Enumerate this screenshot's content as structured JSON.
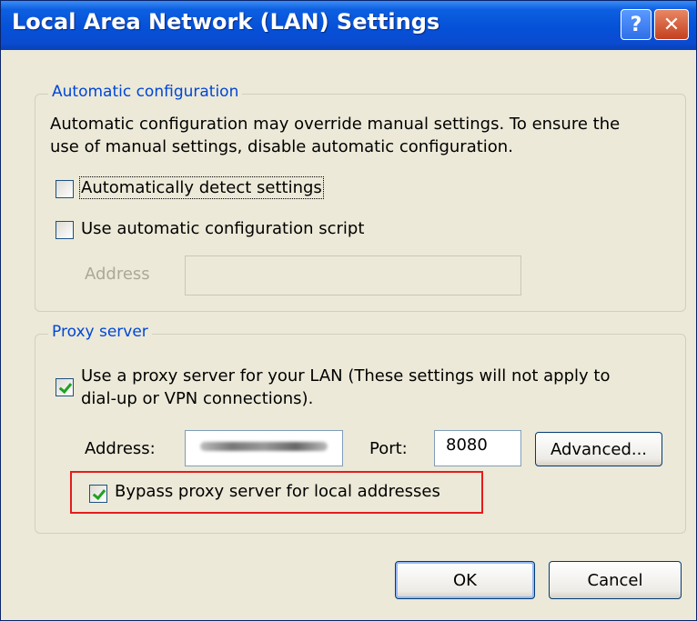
{
  "window": {
    "title": "Local Area Network (LAN) Settings",
    "help_icon": "?",
    "close_icon": "✕"
  },
  "auto_config": {
    "legend": "Automatic configuration",
    "description_line1": "Automatic configuration may override manual settings.  To ensure the",
    "description_line2": "use of manual settings, disable automatic configuration.",
    "detect_label": "Automatically detect settings",
    "detect_checked": false,
    "script_label": "Use automatic configuration script",
    "script_checked": false,
    "address_label": "Address",
    "address_value": ""
  },
  "proxy": {
    "legend": "Proxy server",
    "use_proxy_line1": "Use a proxy server for your LAN (These settings will not apply to",
    "use_proxy_line2": "dial-up or VPN connections).",
    "use_proxy_checked": true,
    "address_label": "Address:",
    "port_label": "Port:",
    "port_value": "8080",
    "advanced_label": "Advanced...",
    "bypass_label": "Bypass proxy server for local addresses",
    "bypass_checked": true
  },
  "buttons": {
    "ok": "OK",
    "cancel": "Cancel"
  },
  "colors": {
    "title_bar": "#0551d8",
    "dialog_bg": "#ece9d8",
    "legend_text": "#0046d5",
    "highlight_box": "#e51c1c",
    "check_mark": "#21a121"
  }
}
